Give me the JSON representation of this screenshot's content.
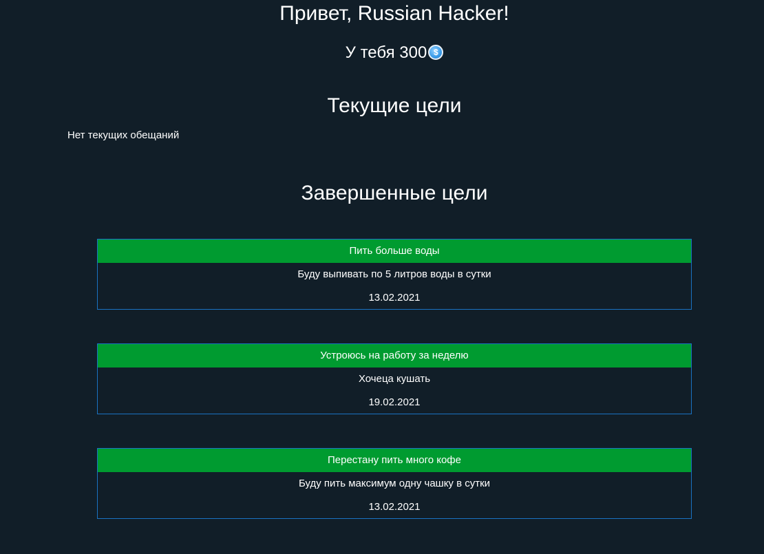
{
  "header": {
    "greeting": "Привет, Russian Hacker!",
    "balance_prefix": "У тебя ",
    "balance_amount": "300",
    "balance_icon": "coin-icon"
  },
  "current_goals": {
    "title": "Текущие цели",
    "empty_text": "Нет текущих обещаний"
  },
  "completed_goals": {
    "title": "Завершенные цели",
    "items": [
      {
        "title": "Пить больше воды",
        "description": "Буду выпивать по 5 литров воды в сутки",
        "date": "13.02.2021"
      },
      {
        "title": "Устроюсь на работу за неделю",
        "description": "Хочеца кушать",
        "date": "19.02.2021"
      },
      {
        "title": "Перестану пить много кофе",
        "description": "Буду пить максимум одну чашку в сутки",
        "date": "13.02.2021"
      }
    ]
  },
  "colors": {
    "background": "#111e28",
    "card_header": "#009b30",
    "card_border": "#1a73c4"
  }
}
